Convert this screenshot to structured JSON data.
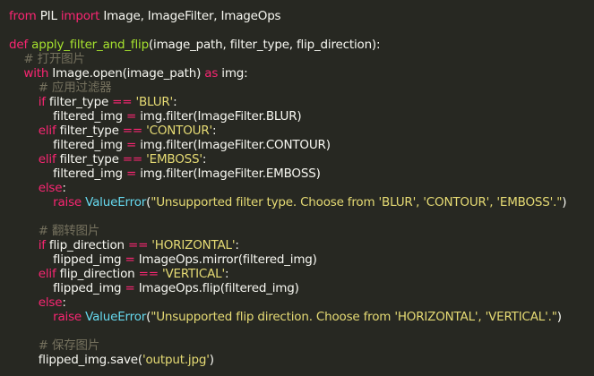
{
  "colors": {
    "background": "#272822",
    "text": "#f8f8f2",
    "keyword": "#f92672",
    "function": "#a6e22e",
    "string": "#e6db74",
    "comment": "#75715e",
    "exception": "#66d9ef"
  },
  "code": {
    "lines": [
      {
        "indent": "",
        "tokens": [
          {
            "t": "from",
            "c": "kw"
          },
          {
            "t": " PIL ",
            "c": "pl"
          },
          {
            "t": "import",
            "c": "kw"
          },
          {
            "t": " Image, ImageFilter, ImageOps",
            "c": "pl"
          }
        ]
      },
      {
        "indent": "",
        "tokens": []
      },
      {
        "indent": "",
        "tokens": [
          {
            "t": "def",
            "c": "kw"
          },
          {
            "t": " ",
            "c": "pl"
          },
          {
            "t": "apply_filter_and_flip",
            "c": "fn"
          },
          {
            "t": "(image_path, filter_type, flip_direction):",
            "c": "pl"
          }
        ]
      },
      {
        "indent": "    ",
        "tokens": [
          {
            "t": "# 打开图片",
            "c": "cm"
          }
        ]
      },
      {
        "indent": "    ",
        "tokens": [
          {
            "t": "with",
            "c": "kw"
          },
          {
            "t": " Image.open(image_path) ",
            "c": "pl"
          },
          {
            "t": "as",
            "c": "kw"
          },
          {
            "t": " img:",
            "c": "pl"
          }
        ]
      },
      {
        "indent": "        ",
        "tokens": [
          {
            "t": "# 应用过滤器",
            "c": "cm"
          }
        ]
      },
      {
        "indent": "        ",
        "tokens": [
          {
            "t": "if",
            "c": "kw"
          },
          {
            "t": " filter_type ",
            "c": "pl"
          },
          {
            "t": "==",
            "c": "kw"
          },
          {
            "t": " ",
            "c": "pl"
          },
          {
            "t": "'BLUR'",
            "c": "str"
          },
          {
            "t": ":",
            "c": "pl"
          }
        ]
      },
      {
        "indent": "            ",
        "tokens": [
          {
            "t": "filtered_img ",
            "c": "pl"
          },
          {
            "t": "=",
            "c": "kw"
          },
          {
            "t": " img.filter(ImageFilter.BLUR)",
            "c": "pl"
          }
        ]
      },
      {
        "indent": "        ",
        "tokens": [
          {
            "t": "elif",
            "c": "kw"
          },
          {
            "t": " filter_type ",
            "c": "pl"
          },
          {
            "t": "==",
            "c": "kw"
          },
          {
            "t": " ",
            "c": "pl"
          },
          {
            "t": "'CONTOUR'",
            "c": "str"
          },
          {
            "t": ":",
            "c": "pl"
          }
        ]
      },
      {
        "indent": "            ",
        "tokens": [
          {
            "t": "filtered_img ",
            "c": "pl"
          },
          {
            "t": "=",
            "c": "kw"
          },
          {
            "t": " img.filter(ImageFilter.CONTOUR)",
            "c": "pl"
          }
        ]
      },
      {
        "indent": "        ",
        "tokens": [
          {
            "t": "elif",
            "c": "kw"
          },
          {
            "t": " filter_type ",
            "c": "pl"
          },
          {
            "t": "==",
            "c": "kw"
          },
          {
            "t": " ",
            "c": "pl"
          },
          {
            "t": "'EMBOSS'",
            "c": "str"
          },
          {
            "t": ":",
            "c": "pl"
          }
        ]
      },
      {
        "indent": "            ",
        "tokens": [
          {
            "t": "filtered_img ",
            "c": "pl"
          },
          {
            "t": "=",
            "c": "kw"
          },
          {
            "t": " img.filter(ImageFilter.EMBOSS)",
            "c": "pl"
          }
        ]
      },
      {
        "indent": "        ",
        "tokens": [
          {
            "t": "else",
            "c": "kw"
          },
          {
            "t": ":",
            "c": "pl"
          }
        ]
      },
      {
        "indent": "            ",
        "tokens": [
          {
            "t": "raise",
            "c": "kw"
          },
          {
            "t": " ",
            "c": "pl"
          },
          {
            "t": "ValueError",
            "c": "ex"
          },
          {
            "t": "(",
            "c": "pl"
          },
          {
            "t": "\"Unsupported filter type. Choose from 'BLUR', 'CONTOUR', 'EMBOSS'.\"",
            "c": "str"
          },
          {
            "t": ")",
            "c": "pl"
          }
        ]
      },
      {
        "indent": "",
        "tokens": []
      },
      {
        "indent": "        ",
        "tokens": [
          {
            "t": "# 翻转图片",
            "c": "cm"
          }
        ]
      },
      {
        "indent": "        ",
        "tokens": [
          {
            "t": "if",
            "c": "kw"
          },
          {
            "t": " flip_direction ",
            "c": "pl"
          },
          {
            "t": "==",
            "c": "kw"
          },
          {
            "t": " ",
            "c": "pl"
          },
          {
            "t": "'HORIZONTAL'",
            "c": "str"
          },
          {
            "t": ":",
            "c": "pl"
          }
        ]
      },
      {
        "indent": "            ",
        "tokens": [
          {
            "t": "flipped_img ",
            "c": "pl"
          },
          {
            "t": "=",
            "c": "kw"
          },
          {
            "t": " ImageOps.mirror(filtered_img)",
            "c": "pl"
          }
        ]
      },
      {
        "indent": "        ",
        "tokens": [
          {
            "t": "elif",
            "c": "kw"
          },
          {
            "t": " flip_direction ",
            "c": "pl"
          },
          {
            "t": "==",
            "c": "kw"
          },
          {
            "t": " ",
            "c": "pl"
          },
          {
            "t": "'VERTICAL'",
            "c": "str"
          },
          {
            "t": ":",
            "c": "pl"
          }
        ]
      },
      {
        "indent": "            ",
        "tokens": [
          {
            "t": "flipped_img ",
            "c": "pl"
          },
          {
            "t": "=",
            "c": "kw"
          },
          {
            "t": " ImageOps.flip(filtered_img)",
            "c": "pl"
          }
        ]
      },
      {
        "indent": "        ",
        "tokens": [
          {
            "t": "else",
            "c": "kw"
          },
          {
            "t": ":",
            "c": "pl"
          }
        ]
      },
      {
        "indent": "            ",
        "tokens": [
          {
            "t": "raise",
            "c": "kw"
          },
          {
            "t": " ",
            "c": "pl"
          },
          {
            "t": "ValueError",
            "c": "ex"
          },
          {
            "t": "(",
            "c": "pl"
          },
          {
            "t": "\"Unsupported flip direction. Choose from 'HORIZONTAL', 'VERTICAL'.\"",
            "c": "str"
          },
          {
            "t": ")",
            "c": "pl"
          }
        ]
      },
      {
        "indent": "",
        "tokens": []
      },
      {
        "indent": "        ",
        "tokens": [
          {
            "t": "# 保存图片",
            "c": "cm"
          }
        ]
      },
      {
        "indent": "        ",
        "tokens": [
          {
            "t": "flipped_img.save(",
            "c": "pl"
          },
          {
            "t": "'output.jpg'",
            "c": "str"
          },
          {
            "t": ")",
            "c": "pl"
          }
        ]
      }
    ]
  }
}
